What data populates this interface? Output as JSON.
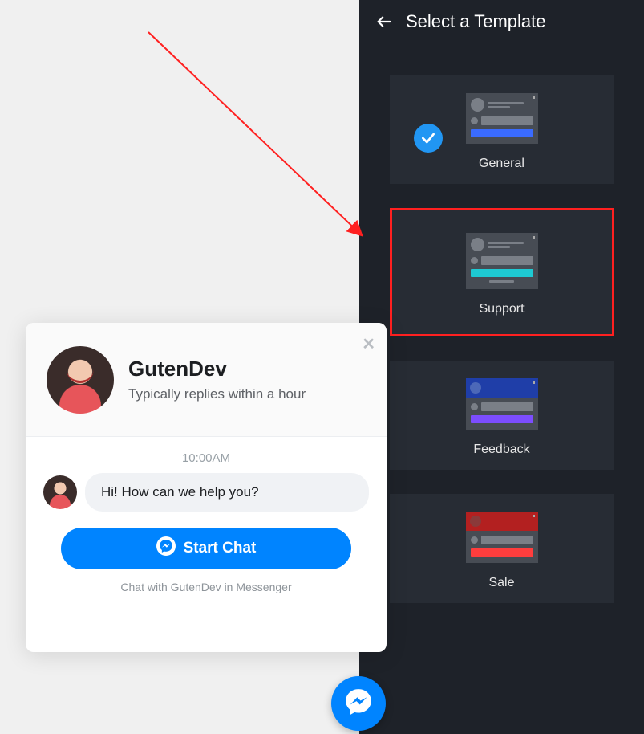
{
  "panel": {
    "title": "Select a Template"
  },
  "templates": [
    {
      "label": "General",
      "accent": "#3a6bff",
      "selected": true,
      "highlighted": false,
      "variant": "basic"
    },
    {
      "label": "Support",
      "accent": "#1ecad3",
      "selected": false,
      "highlighted": true,
      "variant": "basic-caption"
    },
    {
      "label": "Feedback",
      "accent": "#7c4dff",
      "selected": false,
      "highlighted": false,
      "variant": "feedback"
    },
    {
      "label": "Sale",
      "accent": "#ff3d3d",
      "selected": false,
      "highlighted": false,
      "variant": "sale"
    }
  ],
  "chat": {
    "title": "GutenDev",
    "subtitle": "Typically replies within a hour",
    "timestamp": "10:00AM",
    "message": "Hi! How can we help you?",
    "button_label": "Start Chat",
    "footer": "Chat with GutenDev in Messenger"
  }
}
